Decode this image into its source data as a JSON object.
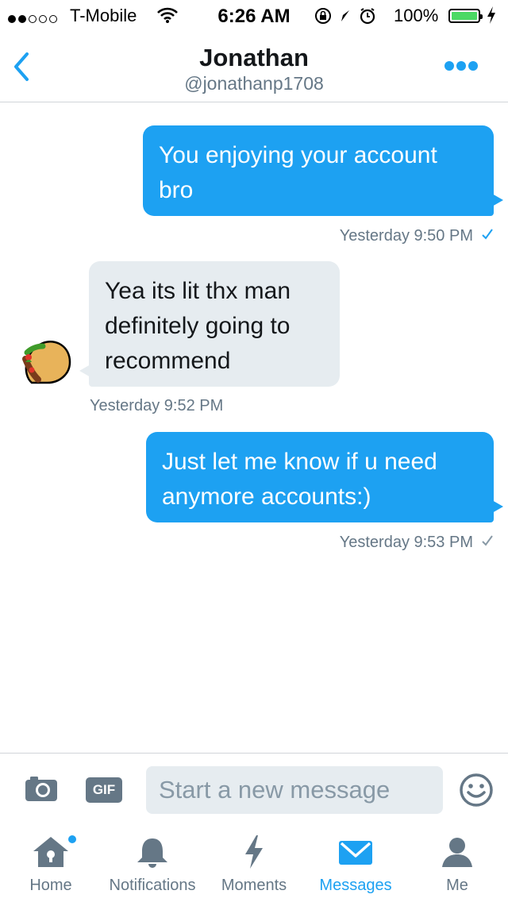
{
  "status_bar": {
    "carrier": "T-Mobile",
    "time": "6:26 AM",
    "battery": "100%"
  },
  "header": {
    "back_icon": "chevron-left-icon",
    "name": "Jonathan",
    "handle": "@jonathanp1708",
    "more_icon": "more-dots-icon"
  },
  "messages": [
    {
      "direction": "sent",
      "text": "You enjoying your account bro",
      "timestamp": "Yesterday 9:50 PM",
      "status_icon": "check-icon",
      "status_color": "#1da1f2"
    },
    {
      "direction": "received",
      "text": "Yea its lit thx man definitely going to recommend",
      "timestamp": "Yesterday 9:52 PM",
      "avatar_icon": "taco-avatar-icon"
    },
    {
      "direction": "sent",
      "text": "Just let me know if u need anymore accounts:)",
      "timestamp": "Yesterday 9:53 PM",
      "status_icon": "check-icon",
      "status_color": "#8899a6"
    }
  ],
  "composer": {
    "camera_icon": "camera-icon",
    "gif_label": "GIF",
    "placeholder": "Start a new message",
    "emoji_icon": "emoji-icon"
  },
  "tabs": [
    {
      "label": "Home",
      "icon": "home-icon",
      "active": false,
      "badge": true
    },
    {
      "label": "Notifications",
      "icon": "bell-icon",
      "active": false
    },
    {
      "label": "Moments",
      "icon": "lightning-icon",
      "active": false
    },
    {
      "label": "Messages",
      "icon": "envelope-icon",
      "active": true
    },
    {
      "label": "Me",
      "icon": "person-icon",
      "active": false
    }
  ],
  "colors": {
    "accent": "#1da1f2",
    "bubble_in": "#e6ecf0",
    "muted": "#657786"
  }
}
